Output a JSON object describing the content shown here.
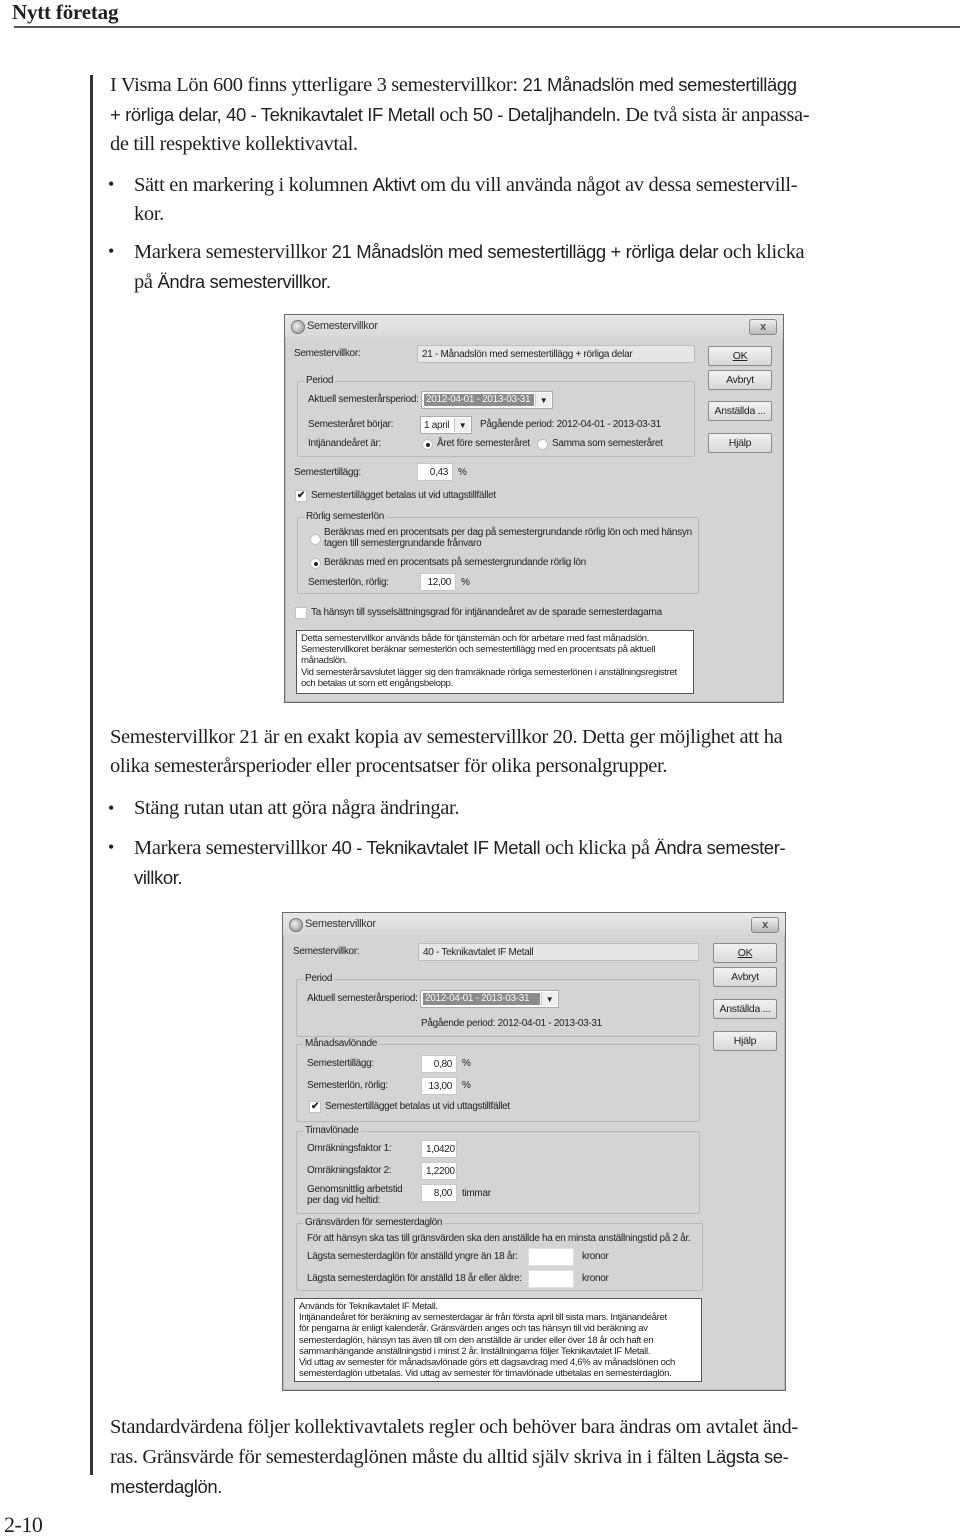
{
  "header": {
    "title": "Nytt företag"
  },
  "page_number": "2-10",
  "intro": {
    "line1": "I Visma Lön 600 finns ytterligare 3 semestervillkor: ",
    "line1_sans": "21 Månadslön med semestertillägg",
    "line2_sans": "+ rörliga delar, 40 - Teknikavtalet IF Metall",
    "line2_serif_a": " och ",
    "line2_sans_b": "50 - Detaljhandeln",
    "line2_serif_c": ". De två sista är anpassa-",
    "line3": "de till respektive kollektivavtal."
  },
  "bullets1": [
    {
      "a": "Sätt en markering i kolumnen ",
      "b": "Aktivt",
      "c": " om du vill använda något av dessa semestervill-",
      "d": "kor."
    },
    {
      "a": "Markera semestervillkor ",
      "b": "21 Månadslön med semestertillägg + rörliga delar",
      "c": " och klicka",
      "d1": "på ",
      "d2": "Ändra semestervillkor."
    }
  ],
  "middle": {
    "line1": "Semestervillkor 21 är en exakt kopia av semestervillkor 20. Detta ger möjlighet att ha",
    "line2": "olika semesterårsperioder eller procentsatser för olika personalgrupper."
  },
  "bullets2": [
    {
      "a": "Stäng rutan utan att göra några ändringar."
    },
    {
      "a": "Markera semestervillkor ",
      "b": "40 - Teknikavtalet IF Metall",
      "c": " och klicka på ",
      "d": "Ändra semester-",
      "e": "villkor."
    }
  ],
  "closing": {
    "line1": "Standardvärdena följer kollektivavtalets regler och behöver bara ändras om avtalet änd-",
    "line2_a": "ras. Gränsvärde för semesterdaglönen måste du alltid själv skriva in i fälten ",
    "line2_b": "Lägsta se-",
    "line3": "mesterdaglön."
  },
  "dialog1": {
    "title": "Semestervillkor",
    "close_label": "x",
    "semestervillkor_label": "Semestervillkor:",
    "semestervillkor_value": "21 - Månadslön med semestertillägg + rörliga delar",
    "buttons": {
      "ok": "OK",
      "avbryt": "Avbryt",
      "anstallda": "Anställda ...",
      "hjalp": "Hjälp"
    },
    "period": {
      "group_label": "Period",
      "aktuell_label": "Aktuell semesterårsperiod:",
      "aktuell_value": "2012-04-01 - 2013-03-31",
      "borjar_label": "Semesteråret börjar:",
      "borjar_value": "1 april",
      "pagaende": "Pågående period: 2012-04-01 - 2013-03-31",
      "intjanande_label": "Intjänandeåret är:",
      "radio1": "Året före semesteråret",
      "radio2": "Samma som semesteråret",
      "radio1_selected": true
    },
    "semestertillagg_label": "Semestertillägg:",
    "semestertillagg_value": "0,43",
    "percent": "%",
    "check_betalas_label": "Semestertillägget betalas ut vid uttagstillfället",
    "check_betalas_checked": true,
    "rorlig": {
      "group_label": "Rörlig semesterlön",
      "radio1_line1": "Beräknas med en procentsats per dag på semestergrundande rörlig lön och med hänsyn",
      "radio1_line2": "tagen till semestergrundande frånvaro",
      "radio2": "Beräknas med en procentsats på semestergrundande rörlig lön",
      "radio2_selected": true,
      "semesterlon_label": "Semesterlön, rörlig:",
      "semesterlon_value": "12,00"
    },
    "check_hansyn_label": "Ta hänsyn till sysselsättningsgrad för intjänandeåret av de sparade semesterdagarna",
    "check_hansyn_checked": false,
    "info": "Detta semestervillkor används både för tjänstemän och för arbetare med fast månadslön.\nSemestervillkoret beräknar semesterlön och semestertillägg med en procentsats på aktuell\nmånadslön.\nVid semesterårsavslutet lägger sig den framräknade rörliga semesterlönen i anställningsregistret\noch betalas ut som ett engångsbelopp."
  },
  "dialog2": {
    "title": "Semestervillkor",
    "close_label": "x",
    "semestervillkor_label": "Semestervillkor:",
    "semestervillkor_value": "40 - Teknikavtalet IF Metall",
    "buttons": {
      "ok": "OK",
      "avbryt": "Avbryt",
      "anstallda": "Anställda ...",
      "hjalp": "Hjälp"
    },
    "period": {
      "group_label": "Period",
      "aktuell_label": "Aktuell semesterårsperiod:",
      "aktuell_value": "2012-04-01 - 2013-03-31",
      "pagaende": "Pågående period: 2012-04-01 - 2013-03-31"
    },
    "manadsavlonade": {
      "group_label": "Månadsavlönade",
      "semestertillagg_label": "Semestertillägg:",
      "semestertillagg_value": "0,80",
      "semesterlon_label": "Semesterlön, rörlig:",
      "semesterlon_value": "13,00",
      "percent": "%",
      "check_label": "Semestertillägget betalas ut vid uttagstillfället",
      "check_checked": true
    },
    "timavlonade": {
      "group_label": "Timavlönade",
      "faktor1_label": "Omräkningsfaktor 1:",
      "faktor1_value": "1,0420",
      "faktor2_label": "Omräkningsfaktor 2:",
      "faktor2_value": "1,2200",
      "arbetstid_label1": "Genomsnittlig arbetstid",
      "arbetstid_label2": "per dag vid heltid:",
      "arbetstid_value": "8,00",
      "arbetstid_unit": "timmar"
    },
    "gransvarden": {
      "group_label": "Gränsvärden för semesterdaglön",
      "note": "För att hänsyn ska tas till gränsvärden ska den anställde ha en minsta anställningstid på 2 år.",
      "yngre_label": "Lägsta semesterdaglön för anställd yngre än 18 år:",
      "yngre_value": "",
      "aldre_label": "Lägsta semesterdaglön för anställd 18 år eller äldre:",
      "aldre_value": "",
      "unit": "kronor"
    },
    "info": "Används för Teknikavtalet IF Metall.\nIntjänandeåret för beräkning av semesterdagar är från första april till sista mars. Intjänandeåret\nför pengarna är enligt kalenderår. Gränsvärden anges och tas hänsyn till vid beräkning av\nsemesterdaglön, hänsyn tas även till om den anställde är under eller över 18 år och haft en\nsammanhängande anställningstid i minst 2 år. Inställningarna följer Teknikavtalet IF Metall.\nVid uttag av semester för månadsavlönade görs ett dagsavdrag med 4,6% av månadslönen och\nsemesterdaglön utbetalas. Vid uttag av semester för timavlönade utbetalas en semesterdaglön."
  }
}
